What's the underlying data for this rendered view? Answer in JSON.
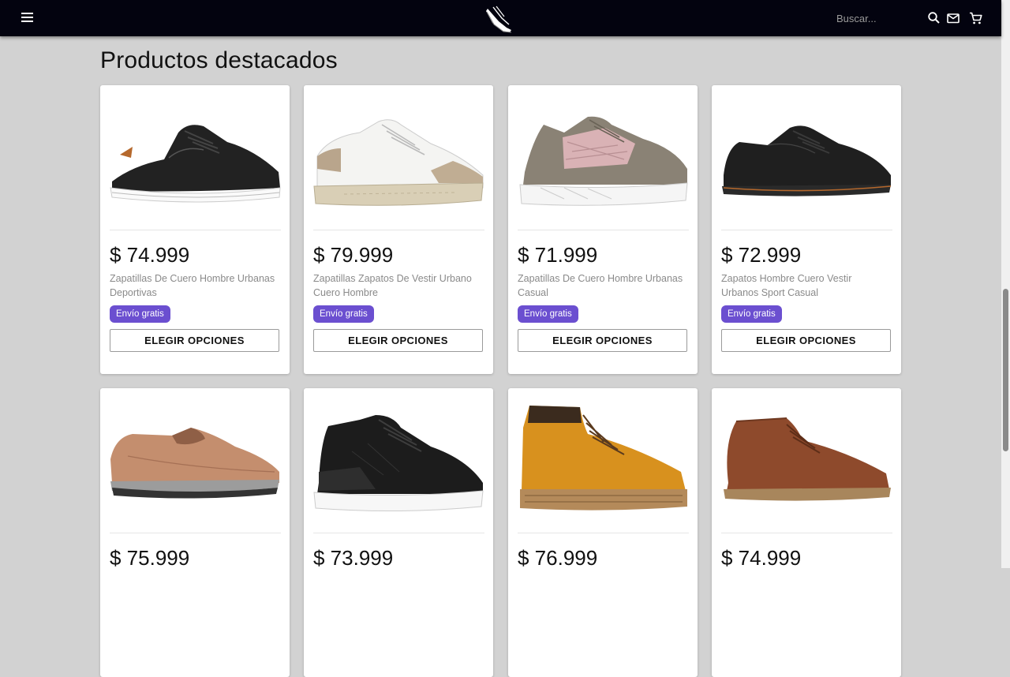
{
  "header": {
    "search_placeholder": "Buscar...",
    "logo": "sneaker-logo-icon"
  },
  "section_title": "Productos destacados",
  "products": [
    {
      "price": "$ 74.999",
      "title": "Zapatillas De Cuero Hombre Urbanas Deportivas",
      "badge": "Envío gratis",
      "button": "ELEGIR OPCIONES",
      "image": "black-leather-sneaker"
    },
    {
      "price": "$ 79.999",
      "title": "Zapatillas Zapatos De Vestir Urbano Cuero Hombre",
      "badge": "Envío gratis",
      "button": "ELEGIR OPCIONES",
      "image": "white-beige-sneaker"
    },
    {
      "price": "$ 71.999",
      "title": "Zapatillas De Cuero Hombre Urbanas Casual",
      "badge": "Envío gratis",
      "button": "ELEGIR OPCIONES",
      "image": "pink-grey-sneaker"
    },
    {
      "price": "$ 72.999",
      "title": "Zapatos Hombre Cuero Vestir Urbanos Sport Casual",
      "badge": "Envío gratis",
      "button": "ELEGIR OPCIONES",
      "image": "black-dress-shoe"
    },
    {
      "price": "$ 75.999",
      "image": "tan-slip-on-loafer"
    },
    {
      "price": "$ 73.999",
      "image": "black-high-top-sneaker"
    },
    {
      "price": "$ 76.999",
      "image": "yellow-work-boot"
    },
    {
      "price": "$ 74.999",
      "image": "brown-chukka-boot"
    }
  ],
  "colors": {
    "topbar": "#03030f",
    "page_bg": "#d2d2d2",
    "badge": "#6b4fd0"
  }
}
